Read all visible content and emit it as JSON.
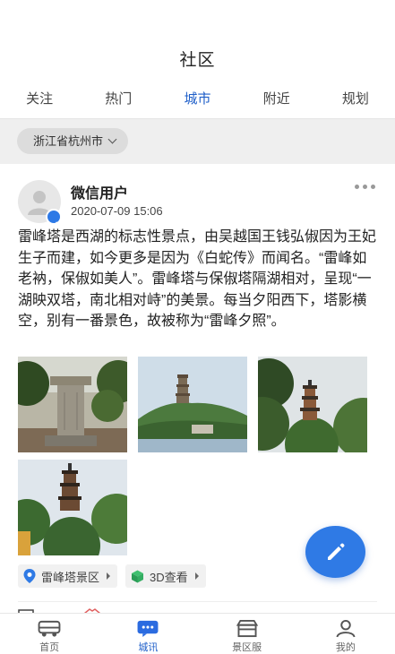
{
  "header": {
    "title": "社区"
  },
  "tabs": [
    {
      "label": "关注",
      "active": false
    },
    {
      "label": "热门",
      "active": false
    },
    {
      "label": "城市",
      "active": true
    },
    {
      "label": "附近",
      "active": false
    },
    {
      "label": "规划",
      "active": false
    }
  ],
  "filter": {
    "region": "浙江省杭州市"
  },
  "post": {
    "username": "微信用户",
    "time": "2020-07-09 15:06",
    "content": "雷峰塔是西湖的标志性景点，由吴越国王钱弘俶因为王妃生子而建，如今更多是因为《白蛇传》而闻名。“雷峰如老衲，保俶如美人”。雷峰塔与保俶塔隔湖相对，呈现“一湖映双塔，南北相对峙”的美景。每当夕阳西下，塔影横空，别有一番景色，故被称为“雷峰夕照”。",
    "location_label": "雷峰塔景区",
    "view3d_label": "3D查看"
  },
  "bottom_nav": [
    {
      "label": "首页",
      "icon": "bus-icon"
    },
    {
      "label": "城讯",
      "icon": "chat-icon"
    },
    {
      "label": "景区服",
      "icon": "store-icon"
    },
    {
      "label": "我的",
      "icon": "person-icon"
    }
  ],
  "colors": {
    "accent": "#2b6be0",
    "fab": "#2f7ae5"
  }
}
